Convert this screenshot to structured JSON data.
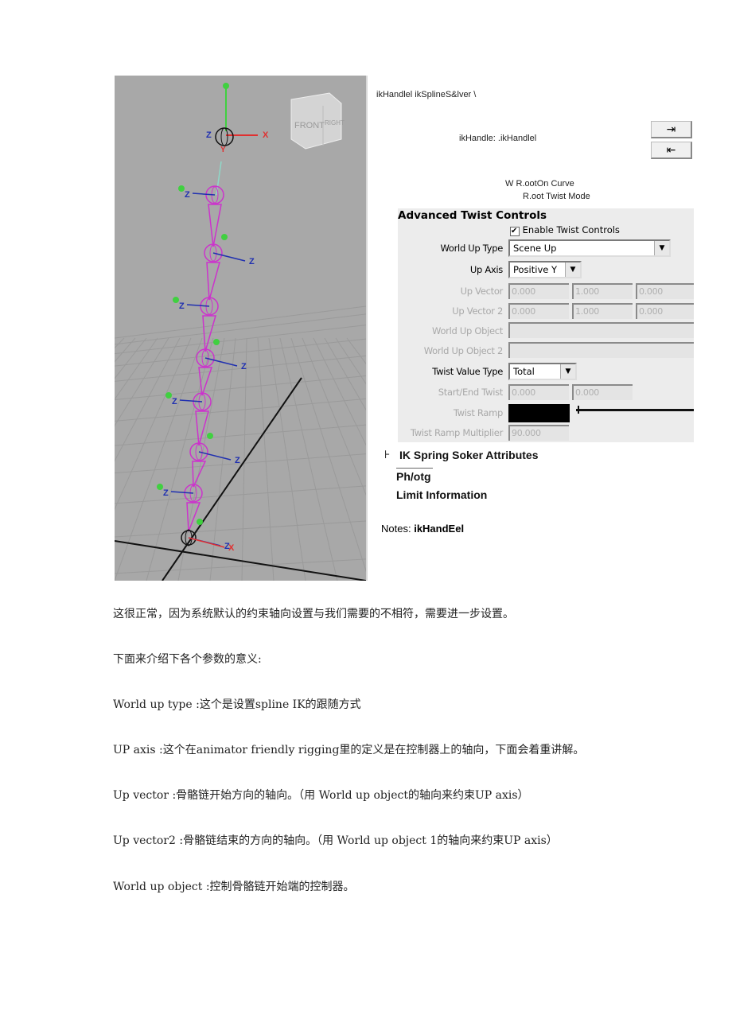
{
  "viewport": {
    "axis_labels": {
      "x": "X",
      "y": "Y",
      "z": "Z"
    },
    "view_cube": {
      "front": "FRONT",
      "right": "RIGHT"
    },
    "colors": {
      "background": "#a8a8a8",
      "joints": "#cc33cc",
      "x_axis": "#e03030",
      "y_axis": "#40d040",
      "z_axis": "#2030b0"
    }
  },
  "header": {
    "node_tabs": "ikHandlel ikSplineS&lver \\",
    "node_name": "ikHandle: .ikHandlel",
    "root_on_curve": "W R.ootOn Curve",
    "root_twist_mode": "R.oot Twist Mode",
    "focus_button_icon": "arrow-in-icon",
    "presets_button_icon": "arrow-out-icon"
  },
  "twist_controls": {
    "title": "Advanced Twist Controls",
    "enable_label": "Enable Twist Controls",
    "enable_checked": true,
    "world_up_type": {
      "label": "World Up Type",
      "value": "Scene Up"
    },
    "up_axis": {
      "label": "Up Axis",
      "value": "Positive Y"
    },
    "up_vector": {
      "label": "Up Vector",
      "values": [
        "0.000",
        "1.000",
        "0.000"
      ]
    },
    "up_vector_2": {
      "label": "Up Vector 2",
      "values": [
        "0.000",
        "1.000",
        "0.000"
      ]
    },
    "world_up_object": {
      "label": "World Up Object",
      "value": ""
    },
    "world_up_object_2": {
      "label": "World Up Object 2",
      "value": ""
    },
    "twist_value_type": {
      "label": "Twist Value Type",
      "value": "Total"
    },
    "start_end_twist": {
      "label": "Start/End Twist",
      "values": [
        "0.000",
        "0.000"
      ]
    },
    "twist_ramp": {
      "label": "Twist Ramp"
    },
    "twist_ramp_multiplier": {
      "label": "Twist Ramp Multiplier",
      "value": "90.000"
    }
  },
  "sections": {
    "ik_spring": "IK Spring Soker Attributes",
    "phong": "Ph/otg",
    "limit": "Limit Information",
    "notes_label": "Notes:",
    "notes_value": "ikHandEel"
  },
  "paragraphs": [
    "这很正常，因为系统默认的约束轴向设置与我们需要的不相符，需要进一步设置。",
    "下面来介绍下各个参数的意义:",
    "World up type :这个是设置spline IK的跟随方式",
    "UP axis :这个在animator friendly rigging里的定义是在控制器上的轴向，下面会着重讲解。",
    "Up vector :骨骼链开始方向的轴向。（用  World up object的轴向来约束UP axis）",
    "Up vector2 :骨骼链结束的方向的轴向。（用  World up object 1的轴向来约束UP axis）",
    "World up object :控制骨骼链开始端的控制器。"
  ]
}
